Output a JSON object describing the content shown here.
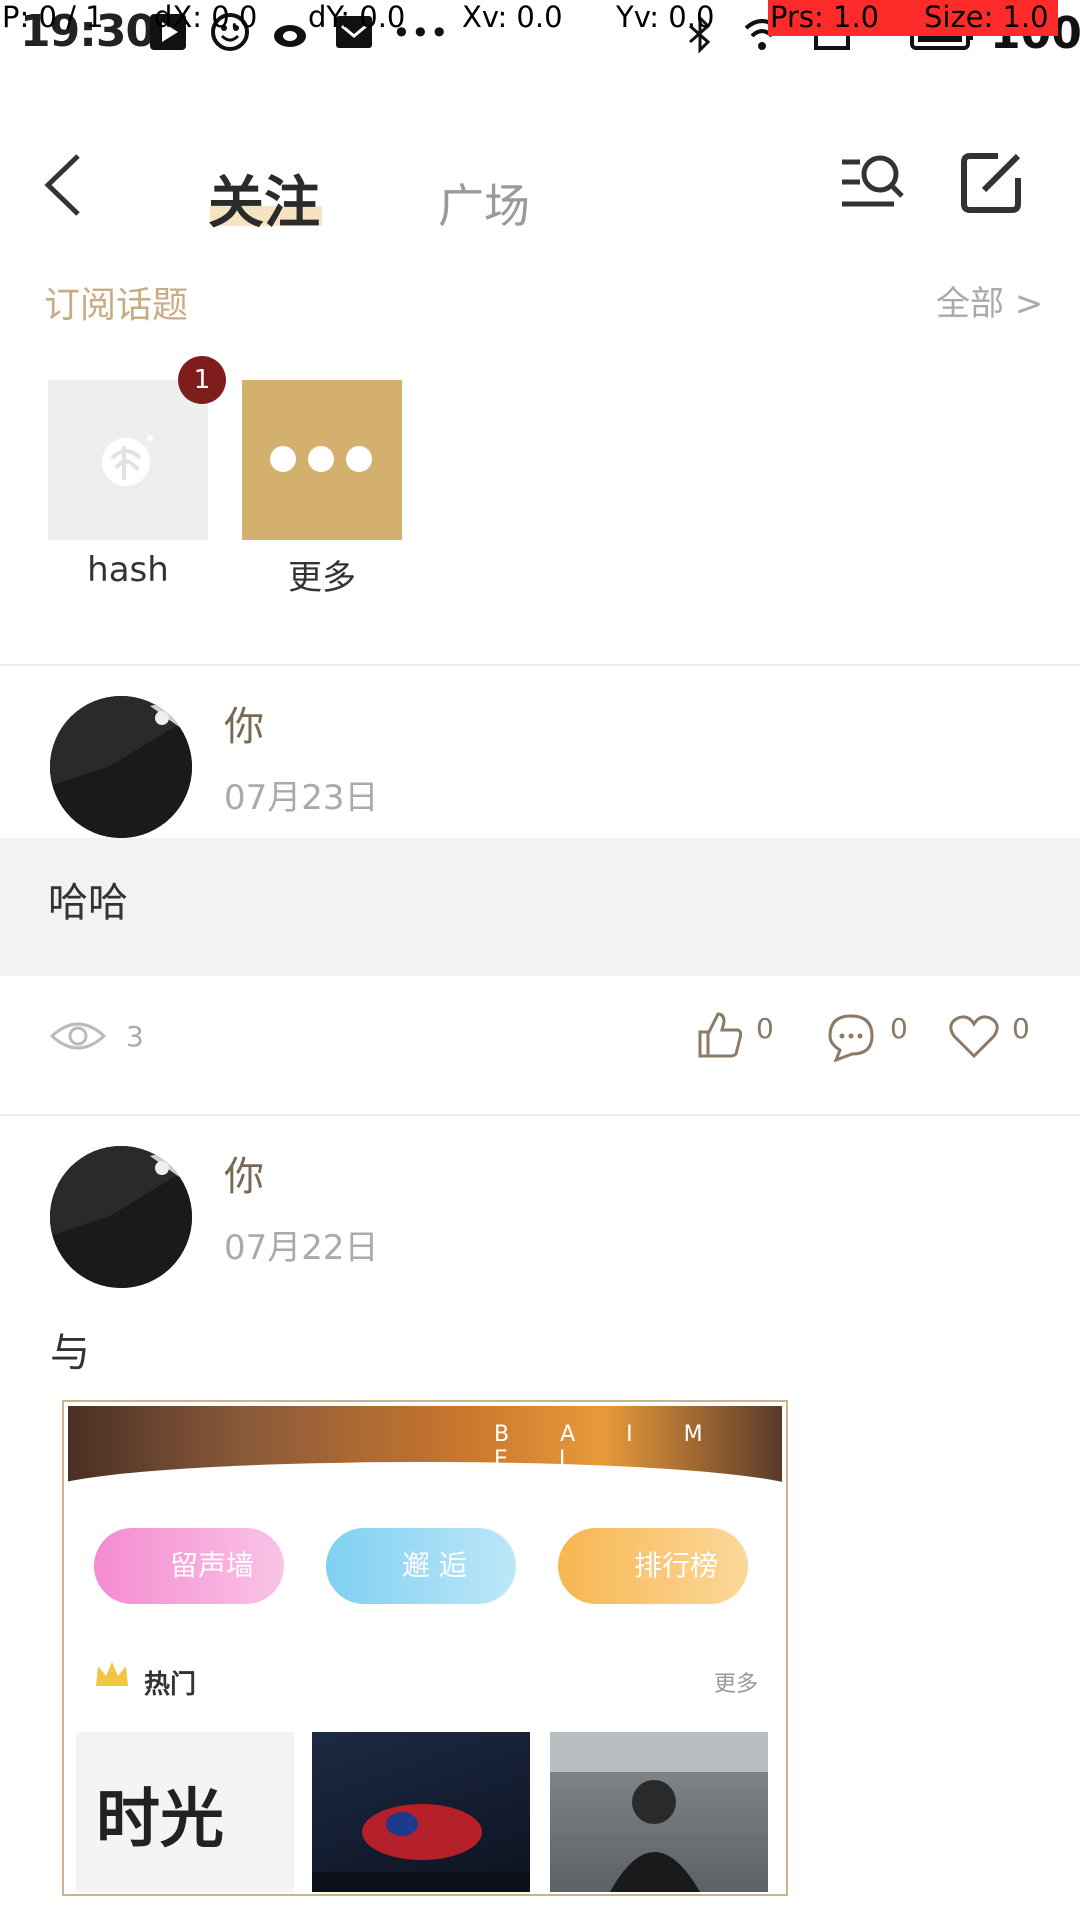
{
  "status_bar": {
    "time": "19:30",
    "battery": "100",
    "debug": {
      "p": "P: 0 / 1",
      "dx": "dX: 0.0",
      "dy": "dY: 0.0",
      "xv": "Xv: 0.0",
      "yv": "Yv: 0.0",
      "prs": "Prs: 1.0",
      "size": "Size: 1.0"
    }
  },
  "header": {
    "tabs": [
      {
        "label": "关注",
        "active": true
      },
      {
        "label": "广场",
        "active": false
      }
    ]
  },
  "subscribed": {
    "title": "订阅话题",
    "all_label": "全部 >",
    "topics": [
      {
        "label": "hash",
        "badge": "1"
      },
      {
        "label": "更多"
      }
    ]
  },
  "posts": [
    {
      "author": "你",
      "date": "07月23日",
      "text": "哈哈",
      "views": "3",
      "likes": "0",
      "comments": "0",
      "favorites": "0"
    },
    {
      "author": "你",
      "date": "07月22日",
      "text": "与",
      "image": {
        "banner_text": "B A I M E I",
        "pills": [
          "留声墙",
          "邂 逅",
          "排行榜"
        ],
        "hot_label": "热门",
        "more_label": "更多",
        "thumb_caption": "时光"
      }
    }
  ],
  "colors": {
    "accent_gold": "#d4b06e",
    "section_title": "#c8ad84",
    "badge": "#7f1d1d",
    "tab_underline": "#f6e3c2"
  }
}
